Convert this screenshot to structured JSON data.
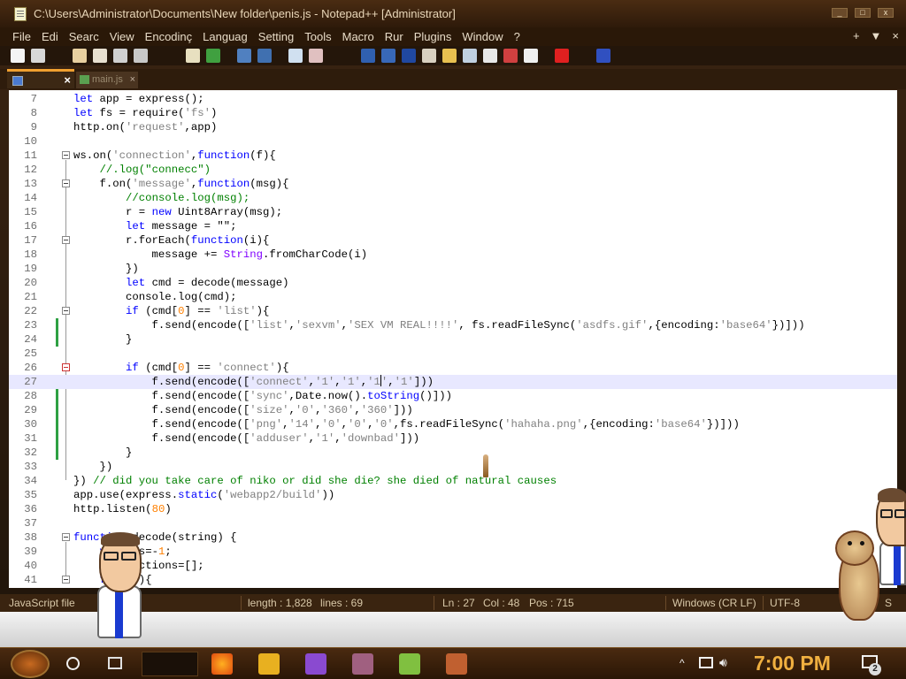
{
  "window": {
    "title": "C:\\Users\\Administrator\\Documents\\New folder\\penis.js - Notepad++ [Administrator]"
  },
  "menu": [
    "File",
    "Edi",
    "Searc",
    "View",
    "Encodinç",
    "Languag",
    "Setting",
    "Tools",
    "Macro",
    "Rur",
    "Plugins",
    "Window",
    "?"
  ],
  "menu_right": {
    "add": "+",
    "dropdown": "▼",
    "close": "×"
  },
  "tabs": [
    {
      "label": "",
      "active": true,
      "close": "×"
    },
    {
      "label": "main.js",
      "active": false,
      "close": "×"
    }
  ],
  "editor": {
    "lines": [
      {
        "n": "7",
        "html": "<span class='kw'>let</span> app = express();"
      },
      {
        "n": "8",
        "html": "<span class='kw'>let</span> fs = require(<span class='str'>'fs'</span>)"
      },
      {
        "n": "9",
        "html": "http.on(<span class='str'>'request'</span>,app)"
      },
      {
        "n": "10",
        "html": ""
      },
      {
        "n": "11",
        "html": "ws.on(<span class='str'>'connection'</span>,<span class='kw'>function</span>(f){"
      },
      {
        "n": "12",
        "html": "    <span class='cmt'>//.log(\"connecc\")</span>"
      },
      {
        "n": "13",
        "html": "    f.on(<span class='str'>'message'</span>,<span class='kw'>function</span>(msg){"
      },
      {
        "n": "14",
        "html": "        <span class='cmt'>//console.log(msg);</span>"
      },
      {
        "n": "15",
        "html": "        r = <span class='kw'>new</span> Uint8Array(msg);"
      },
      {
        "n": "16",
        "html": "        <span class='kw'>let</span> message = \"\";"
      },
      {
        "n": "17",
        "html": "        r.forEach(<span class='kw'>function</span>(i){"
      },
      {
        "n": "18",
        "html": "            message += <span class='typ'>String</span>.fromCharCode(i)"
      },
      {
        "n": "19",
        "html": "        })"
      },
      {
        "n": "20",
        "html": "        <span class='kw'>let</span> cmd = decode(message)"
      },
      {
        "n": "21",
        "html": "        console.log(cmd);"
      },
      {
        "n": "22",
        "html": "        <span class='kw'>if</span> (cmd[<span class='num'>0</span>] == <span class='str'>'list'</span>){"
      },
      {
        "n": "23",
        "html": "            f.send(encode([<span class='str'>'list'</span>,<span class='str'>'sexvm'</span>,<span class='str'>'SEX VM REAL!!!!'</span>, fs.readFileSync(<span class='str'>'asdfs.gif'</span>,{encoding:<span class='str'>'base64'</span>})]))"
      },
      {
        "n": "24",
        "html": "        }"
      },
      {
        "n": "25",
        "html": ""
      },
      {
        "n": "26",
        "html": "        <span class='kw'>if</span> (cmd[<span class='num'>0</span>] == <span class='str'>'connect'</span>){"
      },
      {
        "n": "27",
        "html": "            f.send(encode([<span class='str'>'connect'</span>,<span class='str'>'1'</span>,<span class='str'>'1'</span>,<span class='str'>'1<span class=\"caret\"></span>'</span>,<span class='str'>'1'</span>]))"
      },
      {
        "n": "28",
        "html": "            f.send(encode([<span class='str'>'sync'</span>,Date.now().<span class='kw'>toString</span>()]))"
      },
      {
        "n": "29",
        "html": "            f.send(encode([<span class='str'>'size'</span>,<span class='str'>'0'</span>,<span class='str'>'360'</span>,<span class='str'>'360'</span>]))"
      },
      {
        "n": "30",
        "html": "            f.send(encode([<span class='str'>'png'</span>,<span class='str'>'14'</span>,<span class='str'>'0'</span>,<span class='str'>'0'</span>,<span class='str'>'0'</span>,fs.readFileSync(<span class='str'>'hahaha.png'</span>,{encoding:<span class='str'>'base64'</span>})]))"
      },
      {
        "n": "31",
        "html": "            f.send(encode([<span class='str'>'adduser'</span>,<span class='str'>'1'</span>,<span class='str'>'downbad'</span>]))"
      },
      {
        "n": "32",
        "html": "        }"
      },
      {
        "n": "33",
        "html": "    })"
      },
      {
        "n": "34",
        "html": "}) <span class='cmt'>// did you take care of niko or did she die? she died of natural causes</span>"
      },
      {
        "n": "35",
        "html": "app.use(express.<span class='kw'>static</span>(<span class='str'>'webapp2/build'</span>))"
      },
      {
        "n": "36",
        "html": "http.listen(<span class='num'>80</span>)"
      },
      {
        "n": "37",
        "html": ""
      },
      {
        "n": "38",
        "html": "<span class='kw'>function</span> decode(string) {"
      },
      {
        "n": "39",
        "html": "    <span class='kw'>var</span> pos=-<span class='num'>1</span>;"
      },
      {
        "n": "40",
        "html": "    <span class='kw'>var</span> sections=[];"
      },
      {
        "n": "41",
        "html": "    <span class='kw'>for</span>(;;){"
      }
    ],
    "current_line": "27"
  },
  "status": {
    "type": "JavaScript file",
    "length": "length : 1,828",
    "lines": "lines : 69",
    "ln": "Ln : 27",
    "col": "Col : 48",
    "pos": "Pos : 715",
    "eol": "Windows (CR LF)",
    "encoding": "UTF-8",
    "mode": "S"
  },
  "taskbar": {
    "clock": "7:00 PM",
    "notification_count": "2",
    "tray_up": "^"
  },
  "colors": {
    "accent": "#f0a030",
    "keyword": "#0000ff",
    "string": "#808080",
    "comment": "#008000",
    "number": "#ff8000",
    "change_marker": "#2ea043"
  }
}
